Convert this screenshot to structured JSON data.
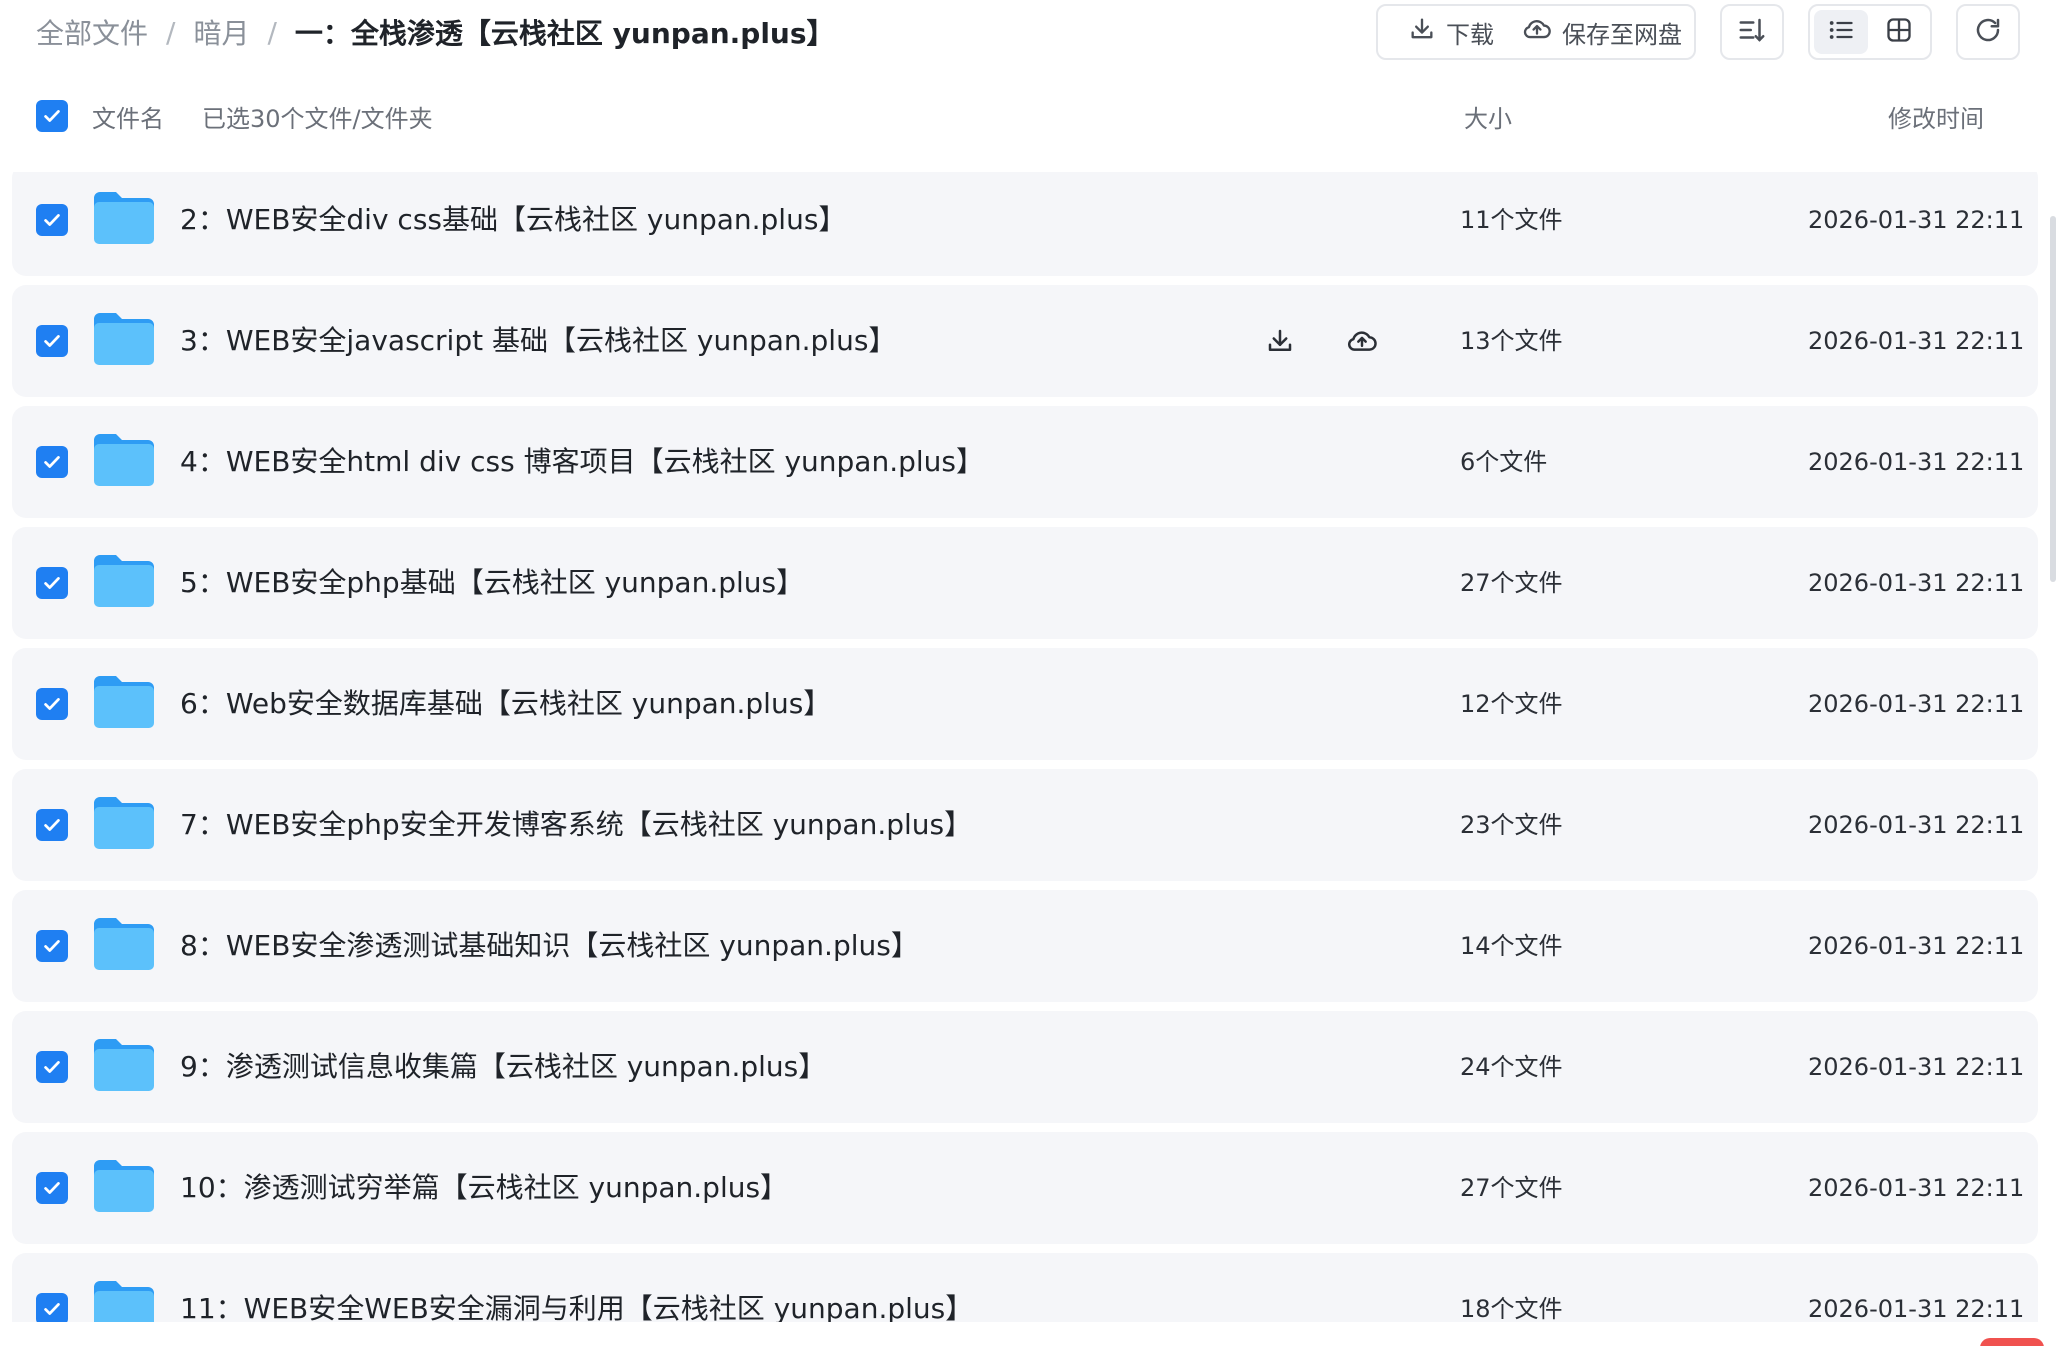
{
  "breadcrumb": {
    "items": [
      "全部文件",
      "暗月"
    ],
    "separator": "/",
    "current": "一：全栈渗透【云栈社区 yunpan.plus】"
  },
  "toolbar": {
    "download_label": "下载",
    "save_label": "保存至网盘",
    "download_icon": "download-icon",
    "save_icon": "cloud-upload-icon",
    "sort_icon": "sort-icon",
    "list_view_icon": "list-view-icon",
    "grid_view_icon": "grid-view-icon",
    "refresh_icon": "refresh-icon"
  },
  "header": {
    "name_label": "文件名",
    "selected_label": "已选30个文件/文件夹",
    "size_label": "大小",
    "time_label": "修改时间",
    "select_all_checked": true
  },
  "colors": {
    "accent": "#1f7ff2",
    "row_bg": "#f5f6f9",
    "folder_top": "#2e9cf4",
    "folder_body": "#5cc1fb"
  },
  "files": [
    {
      "name": "2：WEB安全div css基础【云栈社区 yunpan.plus】",
      "size": "11个文件",
      "modified": "2026-01-31 22:11",
      "checked": true
    },
    {
      "name": "3：WEB安全javascript 基础【云栈社区 yunpan.plus】",
      "size": "13个文件",
      "modified": "2026-01-31 22:11",
      "checked": true
    },
    {
      "name": "4：WEB安全html div css 博客项目【云栈社区 yunpan.plus】",
      "size": "6个文件",
      "modified": "2026-01-31 22:11",
      "checked": true
    },
    {
      "name": "5：WEB安全php基础【云栈社区 yunpan.plus】",
      "size": "27个文件",
      "modified": "2026-01-31 22:11",
      "checked": true
    },
    {
      "name": "6：Web安全数据库基础【云栈社区 yunpan.plus】",
      "size": "12个文件",
      "modified": "2026-01-31 22:11",
      "checked": true
    },
    {
      "name": "7：WEB安全php安全开发博客系统【云栈社区 yunpan.plus】",
      "size": "23个文件",
      "modified": "2026-01-31 22:11",
      "checked": true
    },
    {
      "name": "8：WEB安全渗透测试基础知识【云栈社区 yunpan.plus】",
      "size": "14个文件",
      "modified": "2026-01-31 22:11",
      "checked": true
    },
    {
      "name": "9：渗透测试信息收集篇【云栈社区 yunpan.plus】",
      "size": "24个文件",
      "modified": "2026-01-31 22:11",
      "checked": true
    },
    {
      "name": "10：渗透测试穷举篇【云栈社区 yunpan.plus】",
      "size": "27个文件",
      "modified": "2026-01-31 22:11",
      "checked": true
    },
    {
      "name": "11：WEB安全WEB安全漏洞与利用【云栈社区 yunpan.plus】",
      "size": "18个文件",
      "modified": "2026-01-31 22:11",
      "checked": true
    }
  ],
  "hovered_row_index": 1
}
